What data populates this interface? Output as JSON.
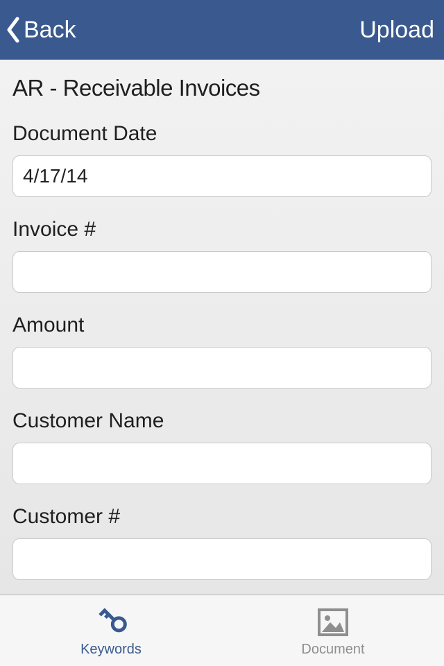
{
  "nav": {
    "back_label": "Back",
    "upload_label": "Upload"
  },
  "page": {
    "title": "AR - Receivable Invoices"
  },
  "fields": {
    "document_date": {
      "label": "Document Date",
      "value": "4/17/14"
    },
    "invoice_no": {
      "label": "Invoice #",
      "value": ""
    },
    "amount": {
      "label": "Amount",
      "value": ""
    },
    "customer_name": {
      "label": "Customer Name",
      "value": ""
    },
    "customer_no": {
      "label": "Customer #",
      "value": ""
    }
  },
  "tabs": {
    "keywords": {
      "label": "Keywords"
    },
    "document": {
      "label": "Document"
    }
  },
  "colors": {
    "primary": "#3a5a8f",
    "inactive": "#8e8e8e"
  }
}
